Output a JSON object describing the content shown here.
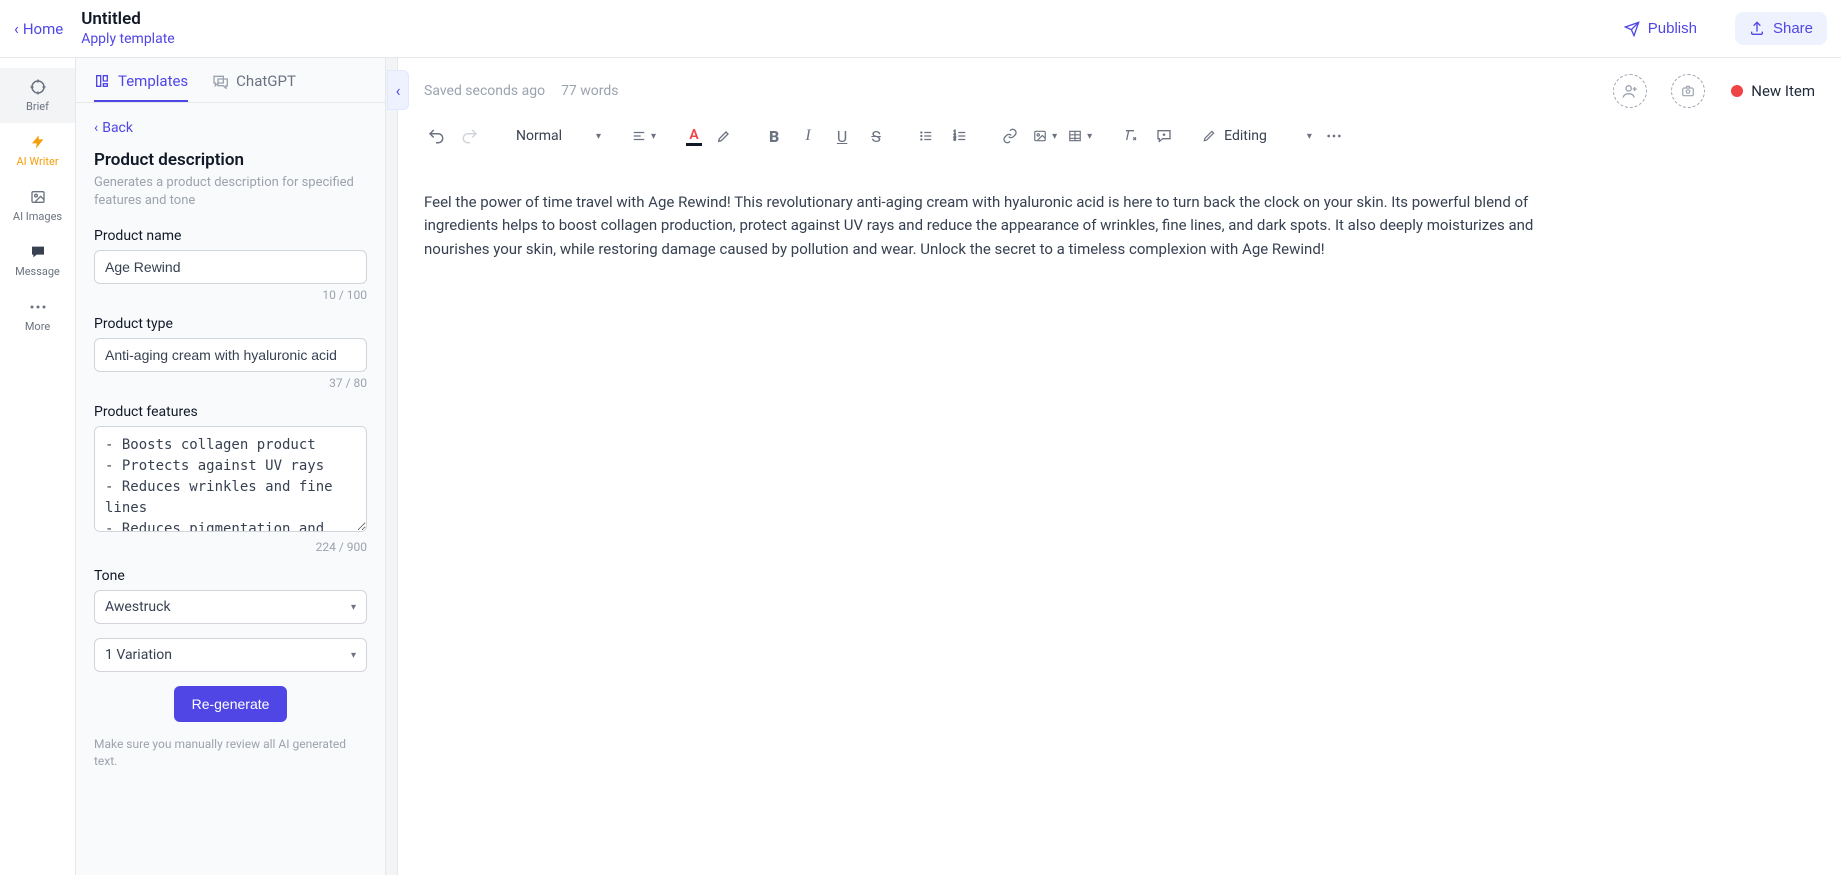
{
  "header": {
    "home": "Home",
    "title": "Untitled",
    "apply_template": "Apply template",
    "publish": "Publish",
    "share": "Share"
  },
  "rail": {
    "items": [
      {
        "label": "Brief"
      },
      {
        "label": "AI Writer"
      },
      {
        "label": "AI Images"
      },
      {
        "label": "Message"
      },
      {
        "label": "More"
      }
    ]
  },
  "panel": {
    "tabs": {
      "templates": "Templates",
      "chatgpt": "ChatGPT"
    },
    "back": "Back",
    "title": "Product description",
    "desc": "Generates a product description for specified features and tone",
    "fields": {
      "product_name": {
        "label": "Product name",
        "value": "Age Rewind",
        "counter": "10 / 100"
      },
      "product_type": {
        "label": "Product type",
        "value": "Anti-aging cream with hyaluronic acid",
        "counter": "37 / 80"
      },
      "product_features": {
        "label": "Product features",
        "value": "- Boosts collagen product\n- Protects against UV rays\n- Reduces wrinkles and fine lines\n- Reduces pigmentation and dark",
        "counter": "224 / 900"
      },
      "tone": {
        "label": "Tone",
        "value": "Awestruck"
      },
      "variation": {
        "value": "1 Variation"
      }
    },
    "regenerate": "Re-generate",
    "note": "Make sure you manually review all AI generated text."
  },
  "editor": {
    "saved": "Saved seconds ago",
    "word_count": "77 words",
    "new_item": "New Item",
    "style": "Normal",
    "mode": "Editing",
    "content": "Feel the power of time travel with Age Rewind! This revolutionary anti-aging cream with hyaluronic acid is here to turn back the clock on your skin. Its powerful blend of ingredients helps to boost collagen production, protect against UV rays and reduce the appearance of wrinkles, fine lines, and dark spots. It also deeply moisturizes and nourishes your skin, while restoring damage caused by pollution and wear. Unlock the secret to a timeless complexion with Age Rewind!"
  }
}
